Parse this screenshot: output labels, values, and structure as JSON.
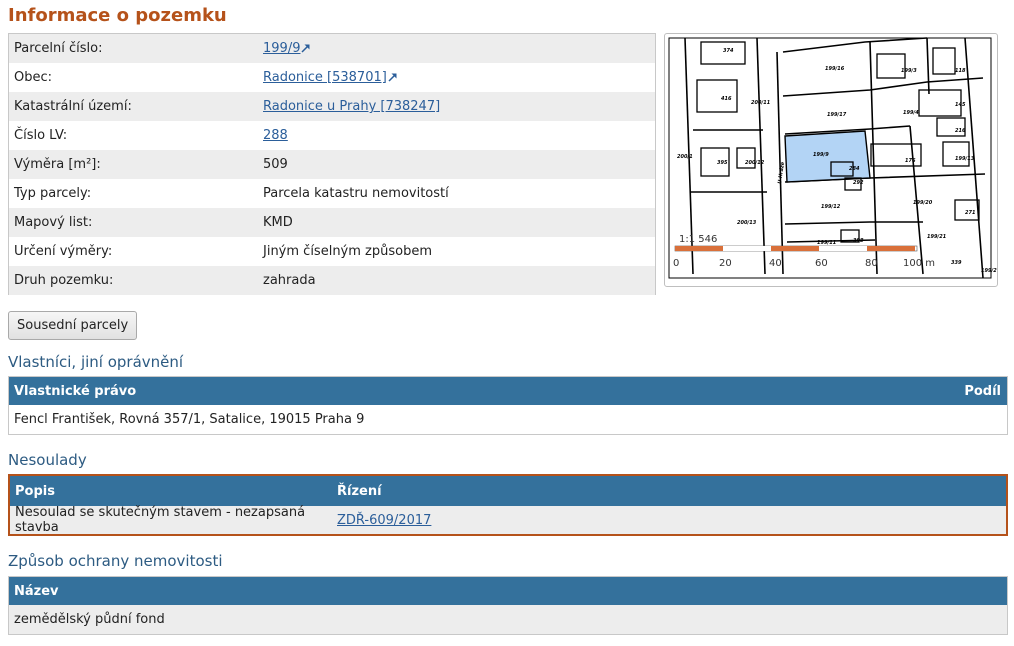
{
  "page_title": "Informace o pozemku",
  "info_rows": [
    {
      "label": "Parcelní číslo:",
      "value": "199/9",
      "link": true,
      "external": true
    },
    {
      "label": "Obec:",
      "value": "Radonice [538701]",
      "link": true,
      "external": true
    },
    {
      "label": "Katastrální území:",
      "value": "Radonice u Prahy [738247]",
      "link": true,
      "external": false
    },
    {
      "label": "Číslo LV:",
      "value": "288",
      "link": true,
      "external": false
    },
    {
      "label": "Výměra [m²]:",
      "value": "509",
      "link": false,
      "external": false
    },
    {
      "label": "Typ parcely:",
      "value": "Parcela katastru nemovitostí",
      "link": false,
      "external": false
    },
    {
      "label": "Mapový list:",
      "value": "KMD",
      "link": false,
      "external": false
    },
    {
      "label": "Určení výměry:",
      "value": "Jiným číselným způsobem",
      "link": false,
      "external": false
    },
    {
      "label": "Druh pozemku:",
      "value": "zahrada",
      "link": false,
      "external": false
    }
  ],
  "map": {
    "scale_text": "1:1 546",
    "scale_ticks": [
      "0",
      "20",
      "40",
      "60",
      "80",
      "100 m"
    ],
    "parcel_labels": [
      "374",
      "199/16",
      "199/3",
      "118",
      "416",
      "200/11",
      "199/17",
      "199/4",
      "145",
      "216",
      "200/1",
      "395",
      "200/12",
      "U Hráze",
      "199/9",
      "284",
      "176",
      "199/13",
      "292",
      "199/12",
      "199/20",
      "271",
      "200/13",
      "199/11",
      "398",
      "199/21",
      "339",
      "199/27"
    ],
    "highlight_color": "#b3d4f5",
    "scale_bar_color": "#d9703a"
  },
  "neighbors_button": "Sousední parcely",
  "owners": {
    "title": "Vlastníci, jiní oprávnění",
    "col_right": "Vlastnické právo",
    "col_share": "Podíl",
    "rows": [
      "Fencl František, Rovná 357/1, Satalice, 19015 Praha 9"
    ]
  },
  "discrepancies": {
    "title": "Nesoulady",
    "col_desc": "Popis",
    "col_proc": "Řízení",
    "rows": [
      {
        "desc": "Nesoulad se skutečným stavem - nezapsaná stavba",
        "proc": "ZDŘ-609/2017"
      }
    ]
  },
  "protection": {
    "title": "Způsob ochrany nemovitosti",
    "col_name": "Název",
    "rows": [
      "zemědělský půdní fond"
    ]
  },
  "colors": {
    "accent": "#b5521a",
    "header": "#34719c",
    "link": "#2b5e9a",
    "section": "#2d5b82"
  }
}
